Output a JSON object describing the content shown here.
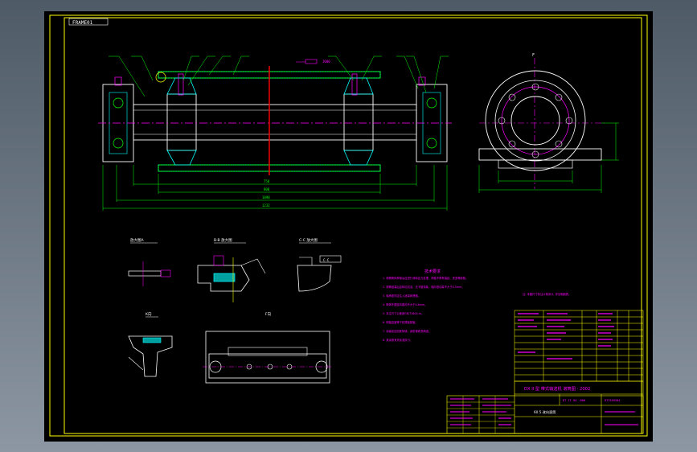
{
  "sheet": {
    "corner_label": "FRAME01",
    "title_block": {
      "main_title": "DX II 型 带式输送机 滚筒图 - 2002",
      "drawing_no": "DT II 04 ·800",
      "part_name": "60.5 改向滚筒",
      "code": "DTII05504"
    }
  },
  "views": {
    "detail_a": "放大图A",
    "detail_b": "B-B 放大图",
    "detail_c": "C-C 放大图",
    "detail_k": "K向",
    "detail_f": "F向",
    "side_label": "F",
    "dim_1": "750",
    "dim_2": "800",
    "dim_3": "1098",
    "dim_4": "1232",
    "section_tag": "1000",
    "callout_tag": "C-C"
  },
  "notes": {
    "heading": "技术要求",
    "items": [
      "1. 滚筒筒体焊接后应进行消除应力处理，焊缝不得有裂纹、夹渣等缺陷。",
      "2. 滚筒组装后应转动灵活，无卡阻现象，轴向窜动量不大于0.5mm。",
      "3. 轴承座内应注入适量润滑脂。",
      "4. 筒体外圆径向跳动不大于0.6mm。",
      "5. 未注尺寸公差按GB/T1804-m。",
      "6. 焊缝高度等于较薄板厚度。",
      "7. 涂装前应彻底除锈，涂防锈底漆两道。",
      "8. 其余按有关标准执行。"
    ],
    "side_note": "注: 本图尺寸标注以毫米计, 详见明细表。"
  },
  "colors": {
    "frame": "#ffff00",
    "outline": "#ffff00",
    "text": "#ff00ff",
    "green": "#00ff00",
    "cyan": "#00ffff",
    "center": "#ff00ff",
    "cut": "#ff0000",
    "white": "#ffffff"
  }
}
